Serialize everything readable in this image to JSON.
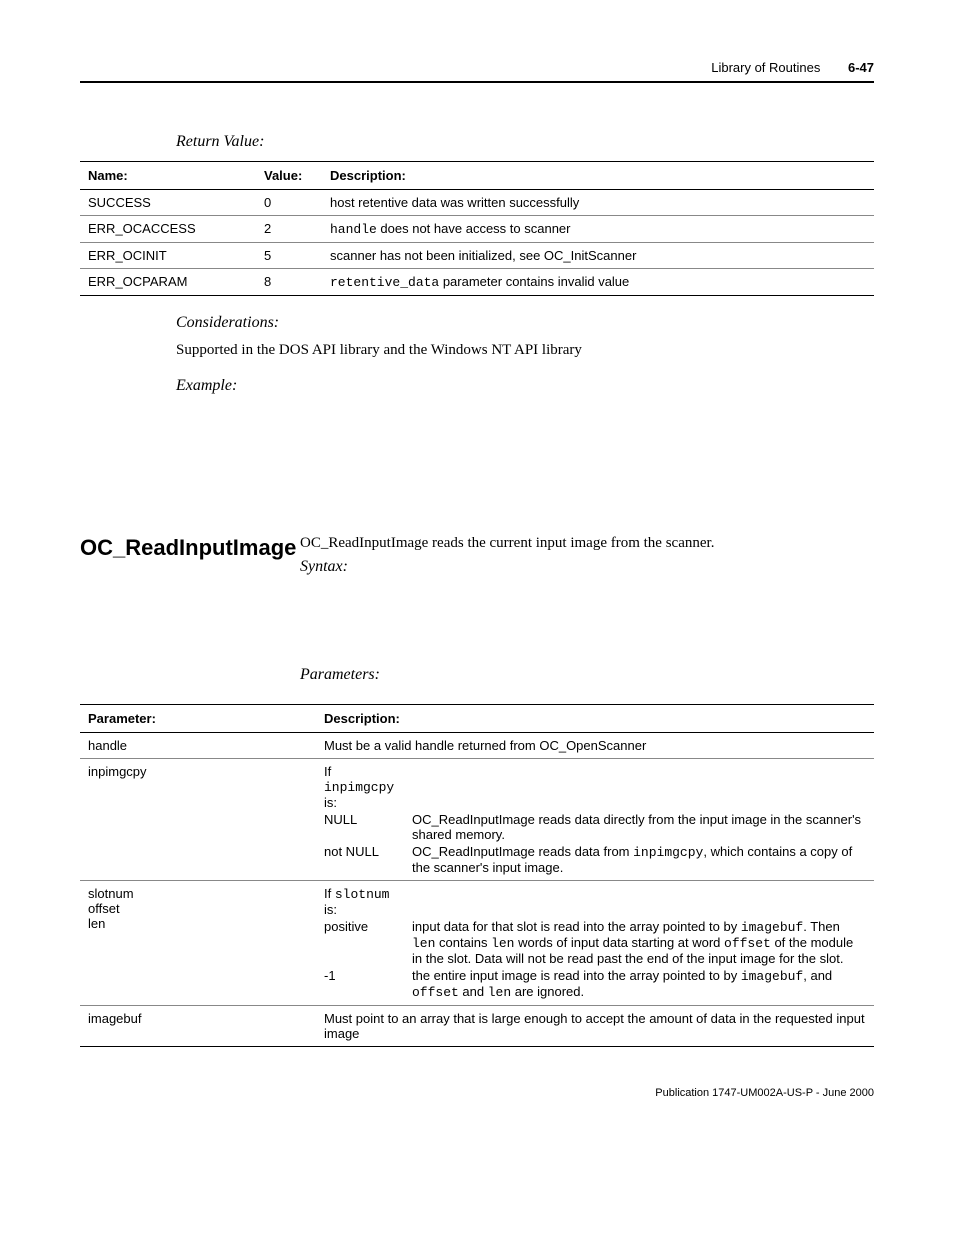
{
  "header": {
    "section": "Library of Routines",
    "page": "6-47"
  },
  "return_value": {
    "label": "Return Value:",
    "columns": {
      "name": "Name:",
      "value": "Value:",
      "description": "Description:"
    },
    "rows": [
      {
        "name": "SUCCESS",
        "value": "0",
        "desc_full": "host retentive data was written successfully"
      },
      {
        "name": "ERR_OCACCESS",
        "value": "2",
        "desc_prefix": "handle",
        "desc_rest": " does not have access to scanner"
      },
      {
        "name": "ERR_OCINIT",
        "value": "5",
        "desc_full": "scanner has not been initialized, see OC_InitScanner"
      },
      {
        "name": "ERR_OCPARAM",
        "value": "8",
        "desc_prefix": "retentive_data",
        "desc_rest": " parameter contains invalid value"
      }
    ]
  },
  "considerations": {
    "label": "Considerations:",
    "text": "Supported in the DOS API library and the Windows NT API library"
  },
  "example": {
    "label": "Example:"
  },
  "routine": {
    "name": "OC_ReadInputImage",
    "intro": "OC_ReadInputImage reads the current input image from the scanner.",
    "syntax_label": "Syntax:",
    "parameters_label": "Parameters:",
    "param_columns": {
      "parameter": "Parameter:",
      "description": "Description:"
    },
    "params": {
      "handle": {
        "name": "handle",
        "desc": "Must be a valid handle returned from OC_OpenScanner"
      },
      "inpimgcpy": {
        "name": "inpimgcpy",
        "if_label": "If",
        "is_label": "is:",
        "code_in_if": "inpimgcpy",
        "rows": [
          {
            "cond": "NULL",
            "desc": "OC_ReadInputImage reads data directly from the input image in the scanner's shared memory."
          },
          {
            "cond": "not NULL",
            "desc_pre": "OC_ReadInputImage reads data from ",
            "desc_code": "inpimgcpy",
            "desc_post": ", which contains a copy of the scanner's input image."
          }
        ]
      },
      "slotnum_group": {
        "names": [
          "slotnum",
          "offset",
          "len"
        ],
        "if_label": "If",
        "is_label": "is:",
        "code_in_if": "slotnum",
        "rows": [
          {
            "cond": "positive",
            "desc_parts": [
              "input data for that slot is read into the array pointed to by ",
              {
                "code": "imagebuf"
              },
              ". Then ",
              {
                "code": "len"
              },
              " contains ",
              {
                "code": "len"
              },
              " words of input data starting at word ",
              {
                "code": "offset"
              },
              " of the module in the slot. Data will not be read past the end of the input image for the slot."
            ]
          },
          {
            "cond": "-1",
            "desc_parts": [
              "the entire input image is read into the array pointed to by ",
              {
                "code": "imagebuf"
              },
              ", and ",
              {
                "code": "offset"
              },
              " and ",
              {
                "code": "len"
              },
              " are ignored."
            ]
          }
        ]
      },
      "imagebuf": {
        "name": "imagebuf",
        "desc": "Must point to an array that is large enough to accept the amount of data in the requested input image"
      }
    }
  },
  "footer": {
    "text": "Publication 1747-UM002A-US-P - June 2000"
  }
}
